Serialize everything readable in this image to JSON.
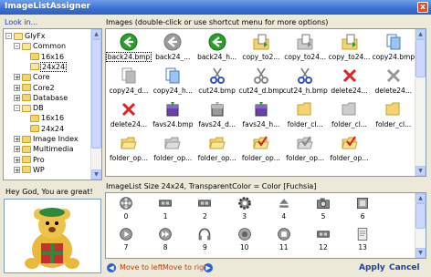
{
  "window": {
    "title": "ImageListAssigner",
    "close_glyph": "x"
  },
  "left": {
    "header": "Look in...",
    "tree": [
      {
        "label": "GlyFx",
        "expander": "-",
        "folder_open": true,
        "indent": 0
      },
      {
        "label": "Common",
        "expander": "-",
        "folder_open": true,
        "indent": 1
      },
      {
        "label": "16x16",
        "expander": "",
        "folder_open": false,
        "indent": 2
      },
      {
        "label": "24x24",
        "expander": "",
        "folder_open": true,
        "indent": 2,
        "selected": true
      },
      {
        "label": "Core",
        "expander": "+",
        "folder_open": false,
        "indent": 1
      },
      {
        "label": "Core2",
        "expander": "+",
        "folder_open": false,
        "indent": 1
      },
      {
        "label": "Database",
        "expander": "+",
        "folder_open": false,
        "indent": 1
      },
      {
        "label": "DB",
        "expander": "-",
        "folder_open": true,
        "indent": 1
      },
      {
        "label": "16x16",
        "expander": "",
        "folder_open": false,
        "indent": 2
      },
      {
        "label": "24x24",
        "expander": "",
        "folder_open": false,
        "indent": 2
      },
      {
        "label": "Image Index",
        "expander": "+",
        "folder_open": false,
        "indent": 1
      },
      {
        "label": "Multimedia",
        "expander": "+",
        "folder_open": false,
        "indent": 1
      },
      {
        "label": "Pro",
        "expander": "+",
        "folder_open": false,
        "indent": 1
      },
      {
        "label": "WP",
        "expander": "+",
        "folder_open": false,
        "indent": 1
      }
    ],
    "greeting": "Hey God, You are great!"
  },
  "images": {
    "header": "Images (double-click or use shortcut menu for more options)",
    "items": [
      {
        "caption": "back24.bmp",
        "icon": "green-back-arrow-icon",
        "selected": true
      },
      {
        "caption": "back24_...",
        "icon": "gray-back-arrow-icon"
      },
      {
        "caption": "back24_h...",
        "icon": "green-back-arrow-icon"
      },
      {
        "caption": "copy_to2...",
        "icon": "copy-to-folder-icon"
      },
      {
        "caption": "copy_to24...",
        "icon": "copy-to-folder-gray-icon"
      },
      {
        "caption": "copy_to24...",
        "icon": "copy-to-folder-icon"
      },
      {
        "caption": "copy24.bmp",
        "icon": "copy-pages-blue-icon"
      },
      {
        "caption": "copy24_d...",
        "icon": "copy-pages-gray-icon"
      },
      {
        "caption": "copy24_h...",
        "icon": "copy-pages-blue-icon"
      },
      {
        "caption": "cut24.bmp",
        "icon": "scissors-blue-icon"
      },
      {
        "caption": "cut24_d.bmp",
        "icon": "scissors-gray-icon"
      },
      {
        "caption": "cut24_h.bmp",
        "icon": "scissors-blue-icon"
      },
      {
        "caption": "delete24...",
        "icon": "delete-x-red-icon"
      },
      {
        "caption": "delete24...",
        "icon": "delete-x-gray-icon"
      },
      {
        "caption": "delete24...",
        "icon": "delete-x-red-icon"
      },
      {
        "caption": "favs24.bmp",
        "icon": "favorites-purple-icon"
      },
      {
        "caption": "favs24_d...",
        "icon": "favorites-gray-icon"
      },
      {
        "caption": "favs24_h...",
        "icon": "favorites-purple-icon"
      },
      {
        "caption": "folder_cl...",
        "icon": "folder-closed-icon"
      },
      {
        "caption": "folder_cl...",
        "icon": "folder-closed-gray-icon"
      },
      {
        "caption": "folder_cl...",
        "icon": "folder-closed-icon"
      },
      {
        "caption": "folder_op...",
        "icon": "folder-open-icon"
      },
      {
        "caption": "folder_op...",
        "icon": "folder-open-gray-icon"
      },
      {
        "caption": "folder_op...",
        "icon": "folder-open-icon"
      },
      {
        "caption": "folder_op...",
        "icon": "folder-open-check-icon"
      },
      {
        "caption": "folder_op...",
        "icon": "folder-open-check-gray-icon"
      },
      {
        "caption": "folder_op...",
        "icon": "folder-open-check-icon"
      }
    ]
  },
  "imagelist": {
    "header": "ImageList Size 24x24, TransparentColor = Color [Fuchsia]",
    "items": [
      {
        "index": "0",
        "icon": "film-reel-icon"
      },
      {
        "index": "1",
        "icon": "film-strip-icon"
      },
      {
        "index": "2",
        "icon": "film-strip-icon"
      },
      {
        "index": "3",
        "icon": "gear-icon"
      },
      {
        "index": "4",
        "icon": "eject-icon"
      },
      {
        "index": "5",
        "icon": "camera-icon"
      },
      {
        "index": "6",
        "icon": "video-tile-icon"
      },
      {
        "index": "7",
        "icon": "play-icon"
      },
      {
        "index": "8",
        "icon": "fast-forward-icon"
      },
      {
        "index": "9",
        "icon": "headphones-icon"
      },
      {
        "index": "10",
        "icon": "speaker-icon"
      },
      {
        "index": "11",
        "icon": "stop-icon"
      },
      {
        "index": "12",
        "icon": "filmstrip-frames-icon"
      },
      {
        "index": "13",
        "icon": "document-icon"
      }
    ]
  },
  "footer": {
    "move_left": "Move to left",
    "move_right": "Move to right",
    "apply": "Apply",
    "cancel": "Cancel",
    "left_glyph": "◀",
    "right_glyph": "▶"
  },
  "colors": {
    "title_bar": "#3a6fd0",
    "link": "#c13a00",
    "action": "#1c3fa8",
    "green_arrow": "#2a9d2a",
    "red_x": "#d22",
    "folder": "#f3d46e"
  }
}
